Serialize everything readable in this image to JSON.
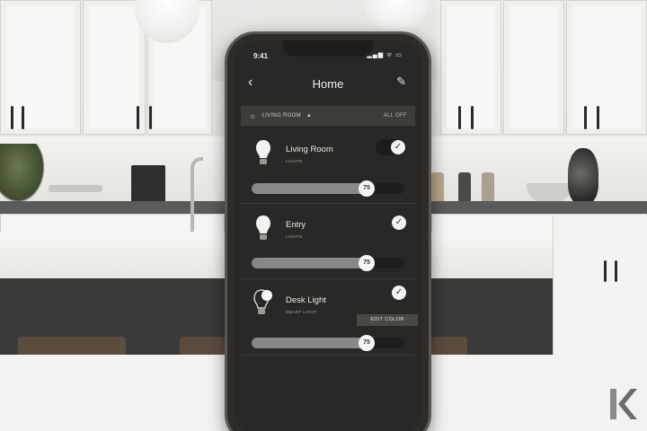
{
  "status_bar": {
    "time": "9:41",
    "icons": "▂▄▆ ᯤ ▭"
  },
  "header": {
    "title": "Home",
    "back_icon": "chevron-left-icon",
    "edit_icon": "pencil-icon"
  },
  "room_bar": {
    "room": "LIVING ROOM",
    "action": "ALL OFF",
    "icon": "sun-icon"
  },
  "lights": [
    {
      "name": "Living Room",
      "type": "LIGHTS",
      "brightness": 75,
      "slider_label": "75",
      "on": true,
      "icon": "bulb-icon"
    },
    {
      "name": "Entry",
      "type": "LIGHTS",
      "brightness": 75,
      "slider_label": "75",
      "on": true,
      "icon": "bulb-icon"
    },
    {
      "name": "Desk Light",
      "type": "SMART LIGHT",
      "brightness": 75,
      "slider_label": "75",
      "on": true,
      "icon": "color-bulb-icon",
      "edit_label": "EDIT COLOR"
    }
  ],
  "brand": {
    "logo": "K",
    "color": "#7a7a7a"
  }
}
